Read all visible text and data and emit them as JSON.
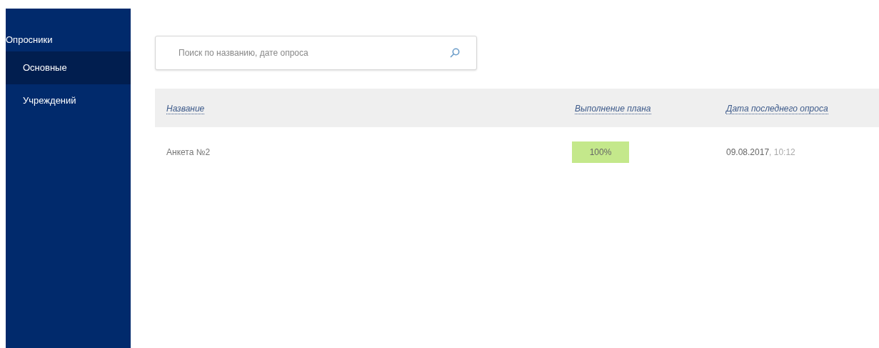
{
  "sidebar": {
    "title": "Опросники",
    "items": [
      {
        "label": "Основные",
        "selected": true
      },
      {
        "label": "Учреждений",
        "selected": false
      }
    ]
  },
  "search": {
    "placeholder": "Поиск по названию, дате опроса"
  },
  "table": {
    "columns": [
      "Название",
      "Выполнение плана",
      "Дата последнего опроса"
    ],
    "rows": [
      {
        "name": "Анкета №2",
        "plan": "100%",
        "date": "09.08.2017",
        "time": ", 10:12"
      }
    ]
  }
}
